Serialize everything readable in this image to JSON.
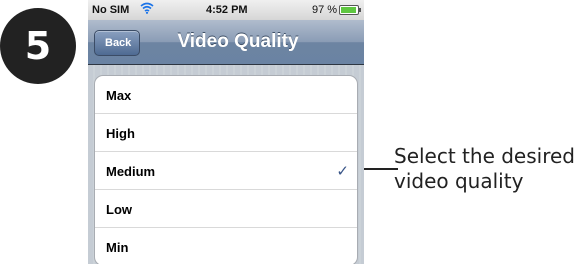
{
  "step_number": "5",
  "status_bar": {
    "carrier": "No SIM",
    "time": "4:52 PM",
    "battery": "97 %"
  },
  "nav": {
    "back_label": "Back",
    "title": "Video Quality"
  },
  "options": [
    {
      "label": "Max",
      "selected": false
    },
    {
      "label": "High",
      "selected": false
    },
    {
      "label": "Medium",
      "selected": true
    },
    {
      "label": "Low",
      "selected": false
    },
    {
      "label": "Min",
      "selected": false
    }
  ],
  "checkmark": "✓",
  "callout": {
    "line1": "Select the desired",
    "line2": "video quality"
  },
  "colors": {
    "nav_bar": "#6d84a2",
    "checkmark": "#385487",
    "battery_fill": "#5ec640"
  }
}
